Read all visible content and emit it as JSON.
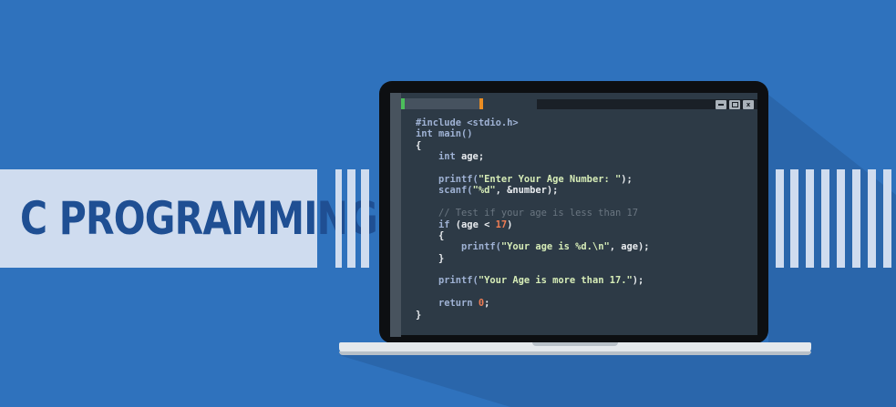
{
  "banner": {
    "title": "C PROGRAMMING"
  },
  "window": {
    "close_label": "x"
  },
  "code": {
    "lines": [
      [
        {
          "t": "#include <stdio.h>",
          "c": "kw"
        }
      ],
      [
        {
          "t": "int ",
          "c": "kw"
        },
        {
          "t": "main()",
          "c": "fn"
        }
      ],
      [
        {
          "t": "{",
          "c": ""
        }
      ],
      [
        {
          "t": "    int ",
          "c": "kw"
        },
        {
          "t": "age;",
          "c": ""
        }
      ],
      [
        {
          "t": "",
          "c": ""
        }
      ],
      [
        {
          "t": "    printf(",
          "c": "fn"
        },
        {
          "t": "\"Enter Your Age Number: \"",
          "c": "str"
        },
        {
          "t": ");",
          "c": ""
        }
      ],
      [
        {
          "t": "    scanf(",
          "c": "fn"
        },
        {
          "t": "\"%d\"",
          "c": "str"
        },
        {
          "t": ", &number);",
          "c": ""
        }
      ],
      [
        {
          "t": "",
          "c": ""
        }
      ],
      [
        {
          "t": "    // Test if your age is less than 17",
          "c": "com"
        }
      ],
      [
        {
          "t": "    if ",
          "c": "kw"
        },
        {
          "t": "(age < ",
          "c": ""
        },
        {
          "t": "17",
          "c": "num"
        },
        {
          "t": ")",
          "c": ""
        }
      ],
      [
        {
          "t": "    {",
          "c": ""
        }
      ],
      [
        {
          "t": "        printf(",
          "c": "fn"
        },
        {
          "t": "\"Your age is %d.\\n\"",
          "c": "str"
        },
        {
          "t": ", age);",
          "c": ""
        }
      ],
      [
        {
          "t": "    }",
          "c": ""
        }
      ],
      [
        {
          "t": "",
          "c": ""
        }
      ],
      [
        {
          "t": "    printf(",
          "c": "fn"
        },
        {
          "t": "\"Your Age is more than 17.\"",
          "c": "str"
        },
        {
          "t": ");",
          "c": ""
        }
      ],
      [
        {
          "t": "",
          "c": ""
        }
      ],
      [
        {
          "t": "    return ",
          "c": "kw"
        },
        {
          "t": "0",
          "c": "num"
        },
        {
          "t": ";",
          "c": ""
        }
      ],
      [
        {
          "t": "}",
          "c": ""
        }
      ]
    ]
  },
  "colors": {
    "background": "#2f72bd",
    "banner": "#cfdcef",
    "title": "#1f4f93",
    "editor": "#2d3a46",
    "string": "#d6ecb7",
    "number": "#ef7d54",
    "keyword": "#9fb2d4",
    "tab_green": "#4cbe5b",
    "tab_orange": "#e98c22"
  }
}
